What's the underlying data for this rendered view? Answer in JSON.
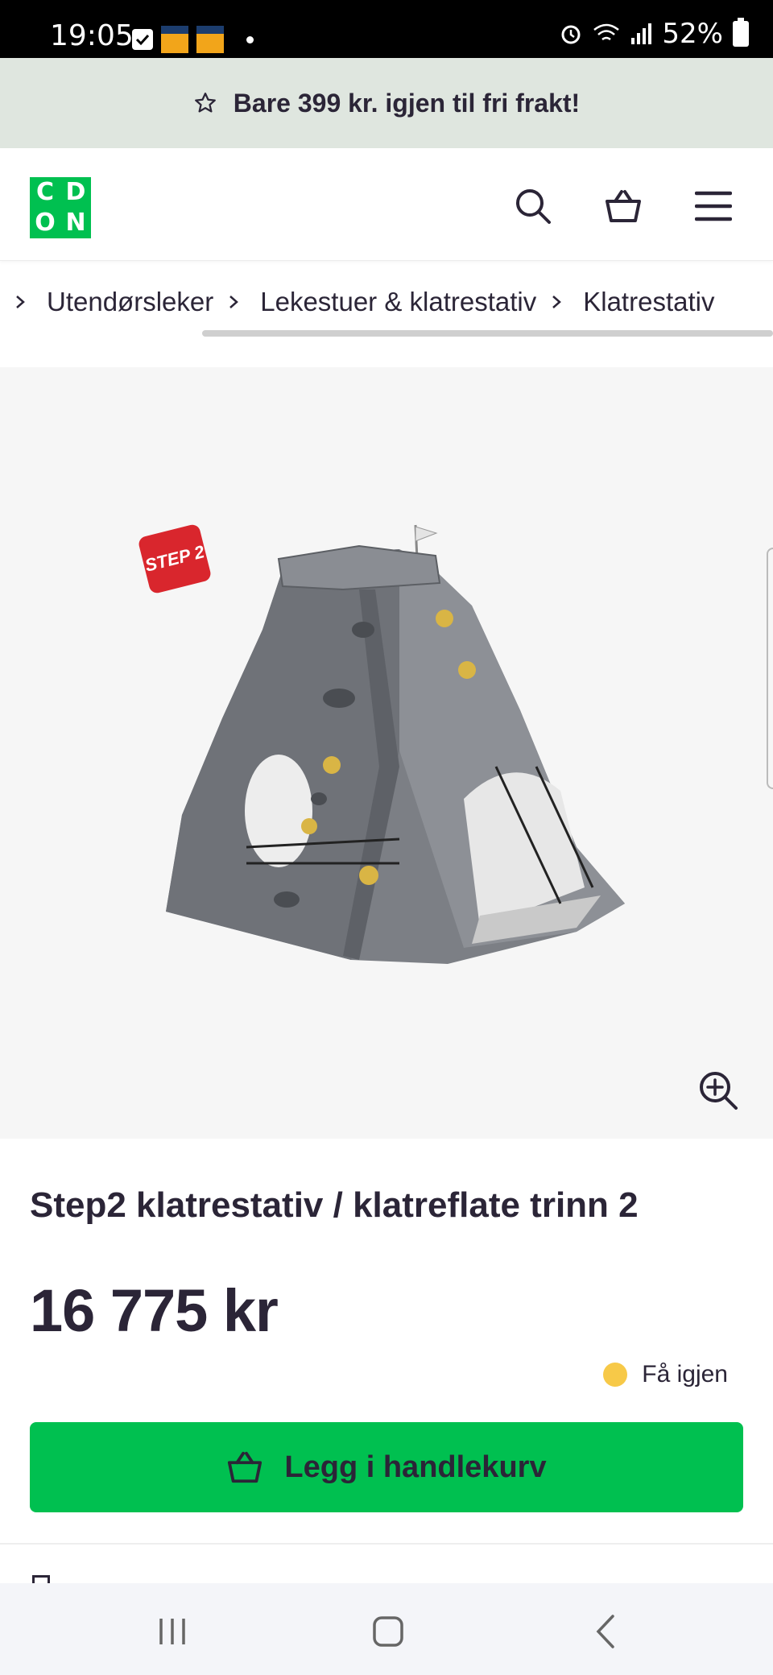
{
  "status_bar": {
    "time": "19:05",
    "battery": "52%"
  },
  "promo": {
    "text": "Bare 399 kr. igjen til fri frakt!",
    "icon": "star-icon"
  },
  "header": {
    "logo": [
      "C",
      "D",
      "O",
      "N"
    ],
    "icons": [
      "search-icon",
      "basket-icon",
      "menu-icon"
    ]
  },
  "breadcrumb": [
    {
      "label": "Utendørsleker"
    },
    {
      "label": "Lekestuer & klatrestativ"
    },
    {
      "label": "Klatrestativ"
    }
  ],
  "product": {
    "brand_logo": "STEP 2",
    "title": "Step2 klatrestativ / klatreflate trinn 2",
    "price": "16 775 kr",
    "stock_status": "Få igjen",
    "stock_color": "#f7c948",
    "add_to_cart": "Legg i handlekurv"
  },
  "colors": {
    "accent": "#00c050",
    "promo_bg": "#dfe6df",
    "text": "#2b2537"
  },
  "navbar": {
    "icons": [
      "recent-apps-icon",
      "home-icon",
      "back-icon"
    ]
  }
}
